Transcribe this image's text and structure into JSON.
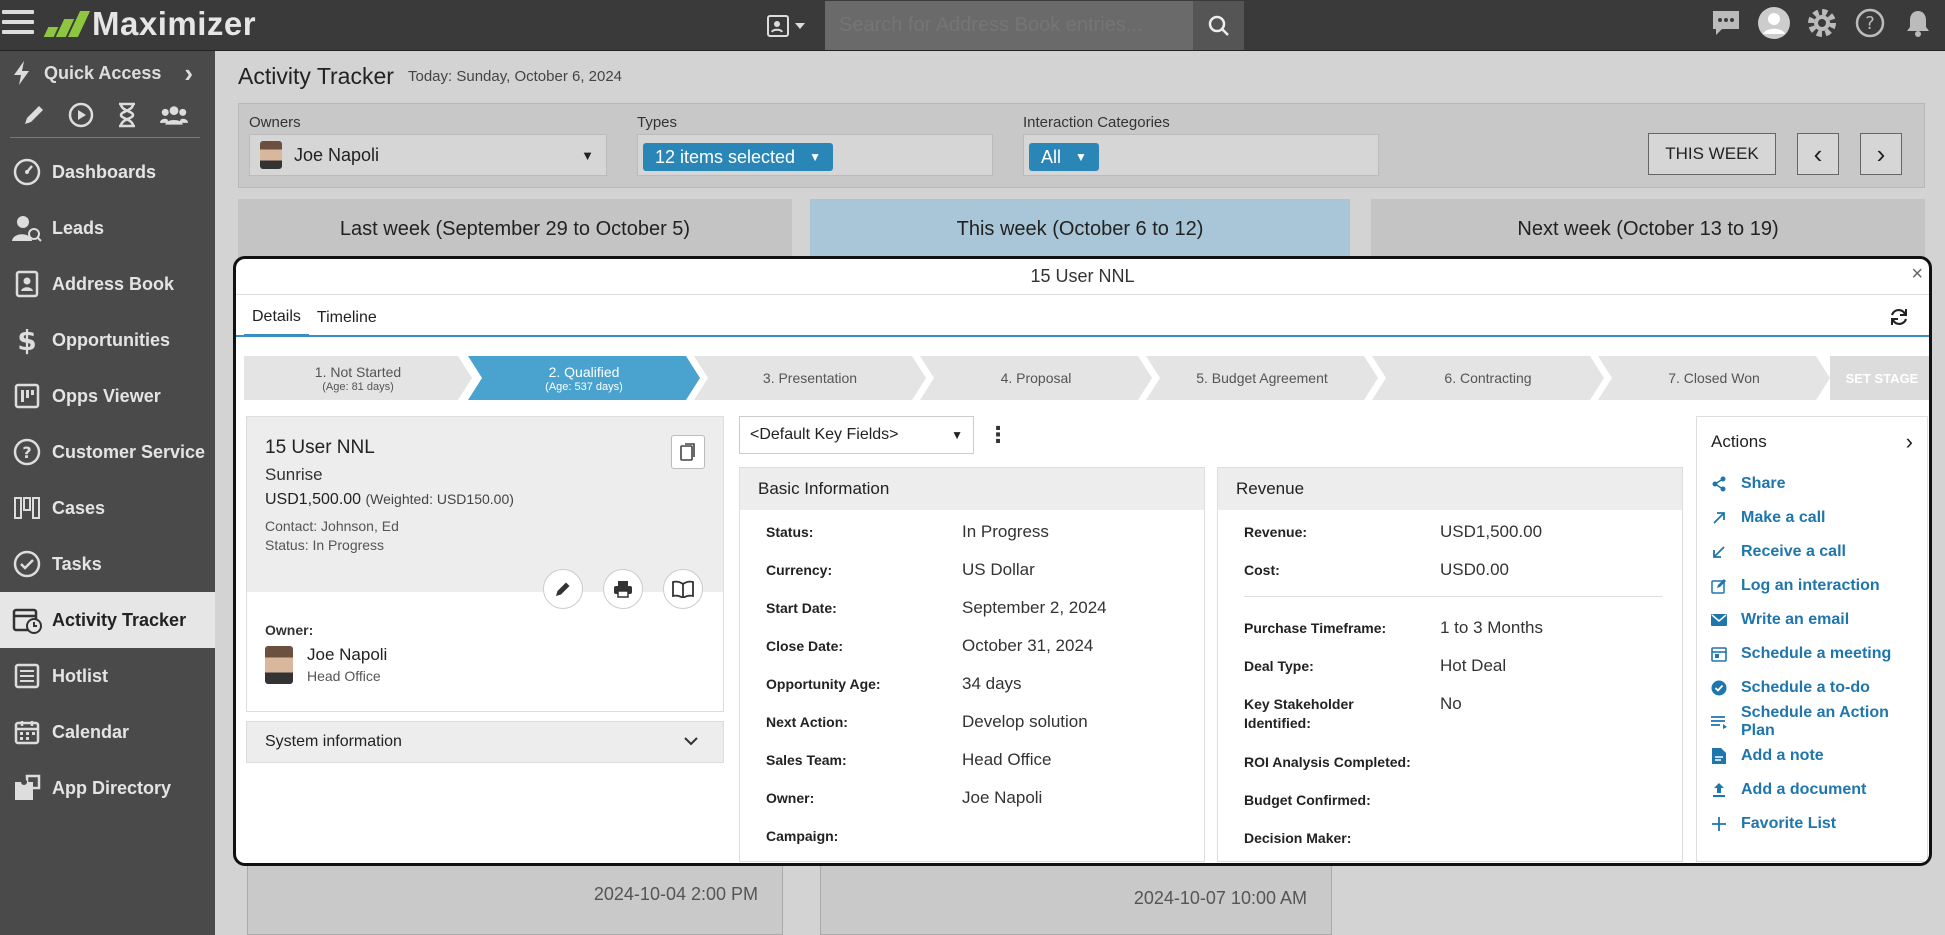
{
  "app": {
    "name": "Maximizer"
  },
  "search": {
    "placeholder": "Search for Address Book entries..."
  },
  "sidebar": {
    "quick_access": "Quick Access",
    "items": [
      {
        "label": "Dashboards"
      },
      {
        "label": "Leads"
      },
      {
        "label": "Address Book"
      },
      {
        "label": "Opportunities"
      },
      {
        "label": "Opps Viewer"
      },
      {
        "label": "Customer Service"
      },
      {
        "label": "Cases"
      },
      {
        "label": "Tasks"
      },
      {
        "label": "Activity Tracker"
      },
      {
        "label": "Hotlist"
      },
      {
        "label": "Calendar"
      },
      {
        "label": "App Directory"
      }
    ]
  },
  "page": {
    "title": "Activity Tracker",
    "date": "Today: Sunday, October 6, 2024"
  },
  "filters": {
    "owners_label": "Owners",
    "owners_value": "Joe Napoli",
    "types_label": "Types",
    "types_value": "12 items selected",
    "categories_label": "Interaction Categories",
    "categories_value": "All",
    "this_week_btn": "THIS WEEK",
    "prev": "‹",
    "next": "›"
  },
  "weeks": {
    "last": "Last week (September 29 to October 5)",
    "this": "This week (October 6 to 12)",
    "next": "Next week (October 13 to 19)"
  },
  "peek": {
    "time1": "2024-10-04 2:00 PM",
    "time2": "2024-10-07 10:00 AM"
  },
  "modal": {
    "title": "15 User NNL",
    "close": "×",
    "tabs": [
      "Details",
      "Timeline"
    ],
    "stages": [
      {
        "name": "1. Not Started",
        "age": "(Age: 81 days)"
      },
      {
        "name": "2. Qualified",
        "age": "(Age: 537 days)"
      },
      {
        "name": "3. Presentation",
        "age": ""
      },
      {
        "name": "4. Proposal",
        "age": ""
      },
      {
        "name": "5. Budget Agreement",
        "age": ""
      },
      {
        "name": "6. Contracting",
        "age": ""
      },
      {
        "name": "7. Closed Won",
        "age": ""
      }
    ],
    "set_stage": "SET STAGE",
    "card": {
      "name": "15 User NNL",
      "company": "Sunrise",
      "amount": "USD1,500.00",
      "weighted": "(Weighted: USD150.00)",
      "contact": "Contact: Johnson, Ed",
      "status": "Status: In Progress",
      "owner_label": "Owner:",
      "owner_name": "Joe Napoli",
      "owner_office": "Head Office"
    },
    "system_info": "System information",
    "key_fields": "<Default Key Fields>",
    "basic": {
      "title": "Basic Information",
      "rows": [
        {
          "label": "Status:",
          "value": "In Progress"
        },
        {
          "label": "Currency:",
          "value": "US Dollar"
        },
        {
          "label": "Start Date:",
          "value": "September 2, 2024"
        },
        {
          "label": "Close Date:",
          "value": "October 31, 2024"
        },
        {
          "label": "Opportunity Age:",
          "value": "34 days"
        },
        {
          "label": "Next Action:",
          "value": "Develop solution"
        },
        {
          "label": "Sales Team:",
          "value": "Head Office"
        },
        {
          "label": "Owner:",
          "value": "Joe Napoli"
        },
        {
          "label": "Campaign:",
          "value": ""
        }
      ]
    },
    "revenue": {
      "title": "Revenue",
      "rows": [
        {
          "label": "Revenue:",
          "value": "USD1,500.00"
        },
        {
          "label": "Cost:",
          "value": "USD0.00"
        },
        {
          "label": "Purchase Timeframe:",
          "value": "1 to 3 Months"
        },
        {
          "label": "Deal Type:",
          "value": "Hot Deal"
        },
        {
          "label": "Key Stakeholder Identified:",
          "value": "No"
        },
        {
          "label": "ROI Analysis Completed:",
          "value": ""
        },
        {
          "label": "Budget Confirmed:",
          "value": ""
        },
        {
          "label": "Decision Maker:",
          "value": ""
        }
      ]
    },
    "actions": {
      "title": "Actions",
      "items": [
        {
          "label": "Share",
          "icon": "share-icon"
        },
        {
          "label": "Make a call",
          "icon": "call-out-icon"
        },
        {
          "label": "Receive a call",
          "icon": "call-in-icon"
        },
        {
          "label": "Log an interaction",
          "icon": "edit-box-icon"
        },
        {
          "label": "Write an email",
          "icon": "email-icon"
        },
        {
          "label": "Schedule a meeting",
          "icon": "calendar-icon"
        },
        {
          "label": "Schedule a to-do",
          "icon": "check-circle-icon"
        },
        {
          "label": "Schedule an Action Plan",
          "icon": "list-icon"
        },
        {
          "label": "Add a note",
          "icon": "note-icon"
        },
        {
          "label": "Add a document",
          "icon": "upload-icon"
        },
        {
          "label": "Favorite List",
          "icon": "plus-icon"
        }
      ]
    }
  },
  "colors": {
    "accent": "#2b86b8",
    "active_stage": "#4aa3cf",
    "logo_green": "#8dc63f",
    "link": "#1f76ad"
  }
}
